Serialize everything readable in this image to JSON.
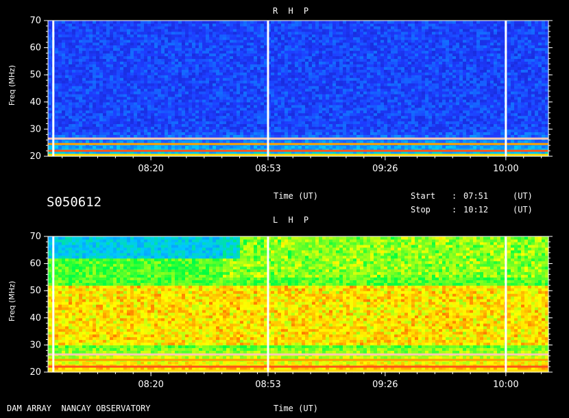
{
  "header": {
    "id_code": "S050612",
    "start_label": "Start",
    "stop_label": "Stop",
    "start_value": "07:51",
    "stop_value": "10:12",
    "separator": ":",
    "unit": "(UT)",
    "footer_text": "DAM ARRAY  NANCAY OBSERVATORY"
  },
  "colors": {
    "background": "#000000",
    "axis": "#ffffff"
  },
  "chart_data": [
    {
      "type": "heatmap",
      "title": "R H P",
      "xlabel": "Time (UT)",
      "ylabel": "Freq (MHz)",
      "xlim": [
        "07:51",
        "10:12"
      ],
      "x_ticks": [
        "08:20",
        "08:53",
        "09:26",
        "10:00"
      ],
      "ylim": [
        20,
        70
      ],
      "y_ticks": [
        20,
        30,
        40,
        50,
        60,
        70
      ],
      "grid": false,
      "colormap": [
        "#1010a0",
        "#1e3cff",
        "#00c8ff",
        "#00ff40",
        "#ffff00",
        "#ff4000",
        "#ffffff"
      ],
      "background_level": 0.17
    },
    {
      "type": "heatmap",
      "title": "L H P",
      "xlabel": "Time (UT)",
      "ylabel": "Freq (MHz)",
      "xlim": [
        "07:51",
        "10:12"
      ],
      "x_ticks": [
        "08:20",
        "08:53",
        "09:26",
        "10:00"
      ],
      "ylim": [
        20,
        70
      ],
      "y_ticks": [
        20,
        30,
        40,
        50,
        60,
        70
      ],
      "grid": false,
      "colormap": [
        "#1010a0",
        "#1e3cff",
        "#00c8ff",
        "#00ff40",
        "#ffff00",
        "#ff4000",
        "#ffffff"
      ],
      "background_level": 0.55
    }
  ]
}
